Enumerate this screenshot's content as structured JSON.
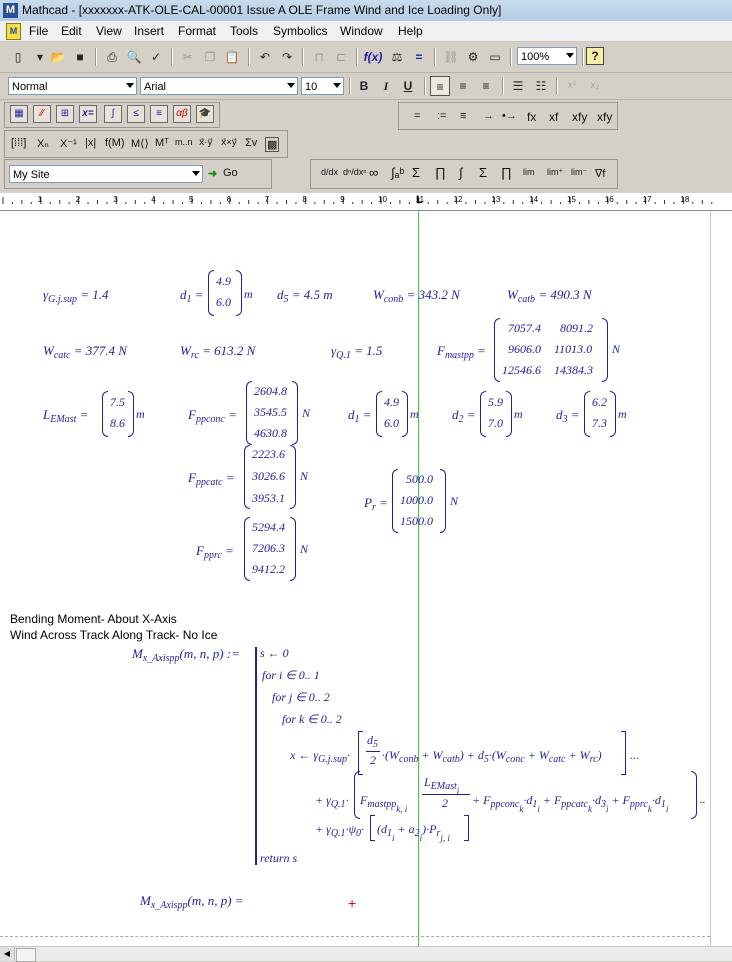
{
  "window": {
    "title": "Mathcad - [xxxxxxx-ATK-OLE-CAL-00001 Issue A OLE Frame Wind and Ice Loading Only]"
  },
  "menu": [
    "File",
    "Edit",
    "View",
    "Insert",
    "Format",
    "Tools",
    "Symbolics",
    "Window",
    "Help"
  ],
  "toolbar": {
    "zoom": "100%"
  },
  "format_bar": {
    "style": "Normal",
    "font": "Arial",
    "size": "10",
    "bold": "B",
    "italic": "I",
    "underline": "U"
  },
  "eval_bar": {
    "symbols": [
      "=",
      ":=",
      "≡",
      "→",
      "•→",
      "fx",
      "xf",
      "xfy",
      "xfy"
    ]
  },
  "resource_bar": {
    "site": "My Site",
    "go": "Go"
  },
  "ruler": {
    "numbers": [
      "1",
      "2",
      "3",
      "4",
      "5",
      "6",
      "7",
      "8",
      "9",
      "10",
      "11",
      "12",
      "13",
      "14",
      "15",
      "16",
      "17",
      "18"
    ]
  },
  "worksheet": {
    "defs": {
      "gamma_g": {
        "name": "γ",
        "sub": "G.j.sup",
        "value": "= 1.4"
      },
      "d1_first": {
        "name": "d",
        "sub": "1",
        "eq": "=",
        "values": [
          "4.9",
          "6.0"
        ],
        "unit": "m"
      },
      "d5": {
        "name": "d",
        "sub": "5",
        "value": "= 4.5 m"
      },
      "w_conb": {
        "name": "W",
        "sub": "conb",
        "value": "= 343.2 N"
      },
      "w_catb": {
        "name": "W",
        "sub": "catb",
        "value": "= 490.3 N"
      },
      "w_catc": {
        "name": "W",
        "sub": "catc",
        "value": "= 377.4 N"
      },
      "w_rc": {
        "name": "W",
        "sub": "rc",
        "value": "= 613.2 N"
      },
      "gamma_q": {
        "name": "γ",
        "sub": "Q.1",
        "value": "= 1.5"
      },
      "f_mastpp": {
        "name": "F",
        "sub": "mastpp",
        "eq": "=",
        "rows": [
          [
            "7057.4",
            "8091.2"
          ],
          [
            "9606.0",
            "11013.0"
          ],
          [
            "12546.6",
            "14384.3"
          ]
        ],
        "unit": "N"
      },
      "l_emast": {
        "name": "L",
        "sub": "EMast",
        "eq": "=",
        "values": [
          "7.5",
          "8.6"
        ],
        "unit": "m"
      },
      "f_ppconc": {
        "name": "F",
        "sub": "ppconc",
        "eq": "=",
        "values": [
          "2604.8",
          "3545.5",
          "4630.8"
        ],
        "unit": "N"
      },
      "d1_second": {
        "name": "d",
        "sub": "1",
        "eq": "=",
        "values": [
          "4.9",
          "6.0"
        ],
        "unit": "m"
      },
      "d2": {
        "name": "d",
        "sub": "2",
        "eq": "=",
        "values": [
          "5.9",
          "7.0"
        ],
        "unit": "m"
      },
      "d3": {
        "name": "d",
        "sub": "3",
        "eq": "=",
        "values": [
          "6.2",
          "7.3"
        ],
        "unit": "m"
      },
      "f_ppcatc": {
        "name": "F",
        "sub": "ppcatc",
        "eq": "=",
        "values": [
          "2223.6",
          "3026.6",
          "3953.1"
        ],
        "unit": "N"
      },
      "p_r": {
        "name": "P",
        "sub": "r",
        "eq": "=",
        "values": [
          "500.0",
          "1000.0",
          "1500.0"
        ],
        "unit": "N"
      },
      "f_pprc": {
        "name": "F",
        "sub": "pprc",
        "eq": "=",
        "values": [
          "5294.4",
          "7206.3",
          "9412.2"
        ],
        "unit": "N"
      }
    },
    "heading1": "Bending Moment- About X-Axis",
    "heading2": "Wind Across Track Along Track- No Ice",
    "program": {
      "lhs": "M",
      "lhs_sub": "x_Axispp",
      "lhs_args": "(m, n, p) :=",
      "line1": "s ← 0",
      "line2": "for  i ∈ 0.. 1",
      "line3": "for  j ∈ 0.. 2",
      "line4": "for  k ∈ 0.. 2",
      "return": "return  s",
      "l1_start": "x ← γ",
      "l1_sub": "G.j.sup",
      "l1_dot": "·",
      "d5_num": "d",
      "d5_sub": "5",
      "two": "2",
      "l1_mid": "·(W",
      "l1_conb": "conb",
      "l1_plus": " + W",
      "l1_catb": "catb",
      "l1_close": ") + d",
      "l1_d5": "5",
      "l1_conc_open": "·(W",
      "l1_conc": "conc",
      "l1_catc_plus": " + W",
      "l1_catc": "catc",
      "l1_rc_plus": " + W",
      "l1_rc": "rc",
      "l1_end": ")",
      "ellipsis": "...",
      "l2_start": "+ γ",
      "l2_sub": "Q.1",
      "l2_dot": "·",
      "l2_f": "F",
      "l2_fsub": "mastpp",
      "l2_fidx": "k, i",
      "l2_num": "L",
      "l2_numsub": "EMast",
      "l2_numidx": "i",
      "l2_den": "2",
      "l2_rest1": "+ F",
      "l2_ppconc": "ppconc",
      "l2_k1": "k",
      "l2_d1": "·d",
      "l2_d1sub": "1",
      "l2_i1": "i",
      "l2_rest2": "+ F",
      "l2_ppcatc": "ppcatc",
      "l2_k2": "k",
      "l2_d3": "·d",
      "l2_d3sub": "3",
      "l2_i2": "i",
      "l2_rest3": "+ F",
      "l2_pprc": "pprc",
      "l2_k3": "k",
      "l2_d1b": "·d",
      "l2_d1bsub": "1",
      "l2_i3": "i",
      "l2_ellipsis": "..",
      "l3_start": "+ γ",
      "l3_sub": "Q.1",
      "l3_psi": "·ψ",
      "l3_psisub": "0",
      "l3_dot": "·",
      "l3_d": "(d",
      "l3_dsub": "1",
      "l3_di": "i",
      "l3_plus": " + a",
      "l3_asub": "2",
      "l3_ai": "i",
      "l3_close": ")·P",
      "l3_psub": "r",
      "l3_pidx": "j, i"
    },
    "eval": {
      "lhs": "M",
      "lhs_sub": "x_Axispp",
      "args": "(m, n, p) ="
    }
  }
}
